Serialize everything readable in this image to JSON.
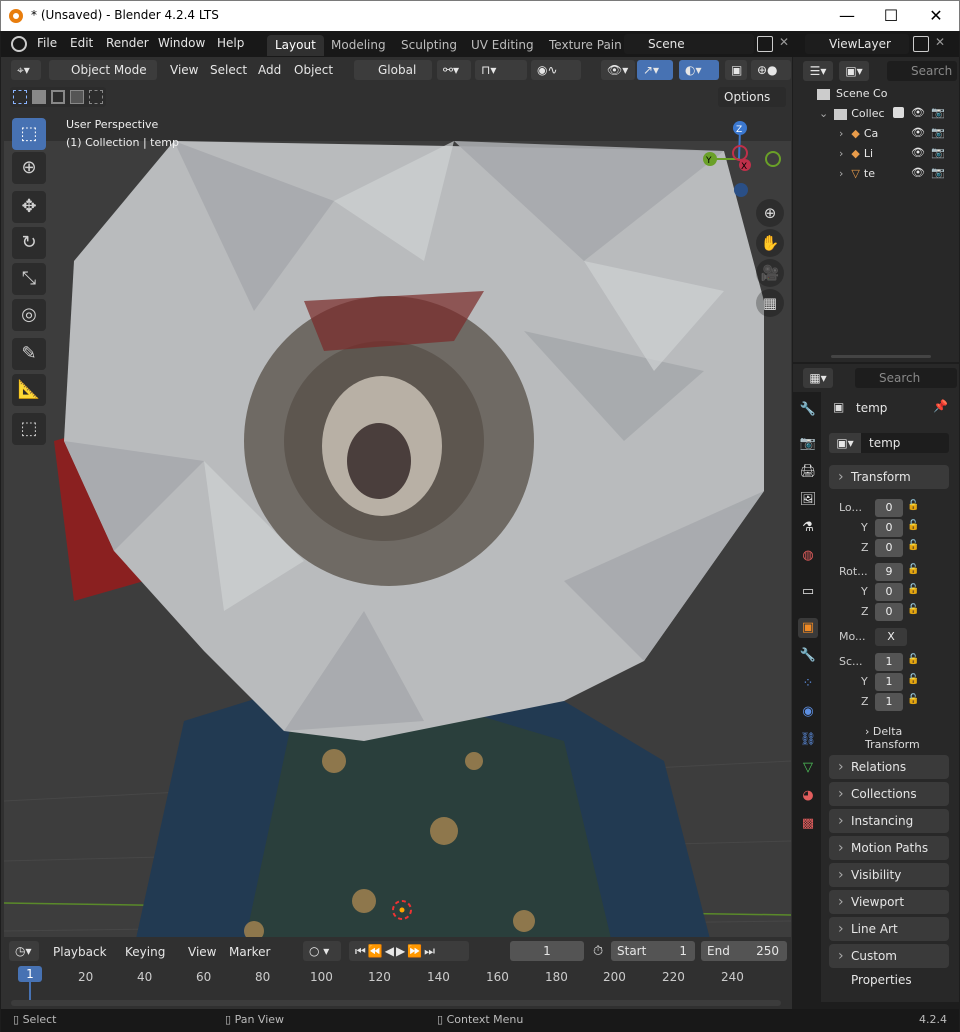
{
  "window": {
    "title": "* (Unsaved) - Blender 4.2.4 LTS",
    "minimize": "—",
    "maximize": "☐",
    "close": "✕"
  },
  "menu": {
    "file": "File",
    "edit": "Edit",
    "render": "Render",
    "window": "Window",
    "help": "Help"
  },
  "workspaces": [
    "Layout",
    "Modeling",
    "Sculpting",
    "UV Editing",
    "Texture Pain"
  ],
  "scene": {
    "name": "Scene",
    "viewlayer": "ViewLayer"
  },
  "viewport_header": {
    "mode": "Object Mode",
    "view": "View",
    "select": "Select",
    "add": "Add",
    "object": "Object",
    "orientation": "Global",
    "options": "Options"
  },
  "viewport": {
    "perspective": "User Perspective",
    "collection": "(1) Collection | temp"
  },
  "gizmo": {
    "z": "Z",
    "y": "Y",
    "x": "X"
  },
  "outliner": {
    "search": "Search",
    "scene_collection": "Scene Co",
    "collection": "Collec",
    "items": [
      "Ca",
      "Li",
      "te"
    ]
  },
  "properties": {
    "search": "Search",
    "object_name": "temp",
    "data_name": "temp",
    "transform": "Transform",
    "location_label": "Lo...",
    "rotation_label": "Rot...",
    "mode_label": "Mo...",
    "scale_label": "Sc...",
    "y": "Y",
    "z": "Z",
    "loc": [
      "0",
      "0",
      "0"
    ],
    "rot": [
      "9",
      "0",
      "0"
    ],
    "rot_mode": "X",
    "scale": [
      "1",
      "1",
      "1"
    ],
    "delta": "Delta Transform",
    "panels": [
      "Relations",
      "Collections",
      "Instancing",
      "Motion Paths",
      "Visibility",
      "Viewport Display",
      "Line Art",
      "Custom Properties"
    ]
  },
  "timeline": {
    "playback": "Playback",
    "keying": "Keying",
    "view": "View",
    "marker": "Marker",
    "current": "1",
    "start_label": "Start",
    "start": "1",
    "end_label": "End",
    "end": "250",
    "ticks": [
      "1",
      "20",
      "40",
      "60",
      "80",
      "100",
      "120",
      "140",
      "160",
      "180",
      "200",
      "220",
      "240"
    ]
  },
  "status": {
    "select": "Select",
    "pan": "Pan View",
    "context": "Context Menu",
    "version": "4.2.4"
  }
}
